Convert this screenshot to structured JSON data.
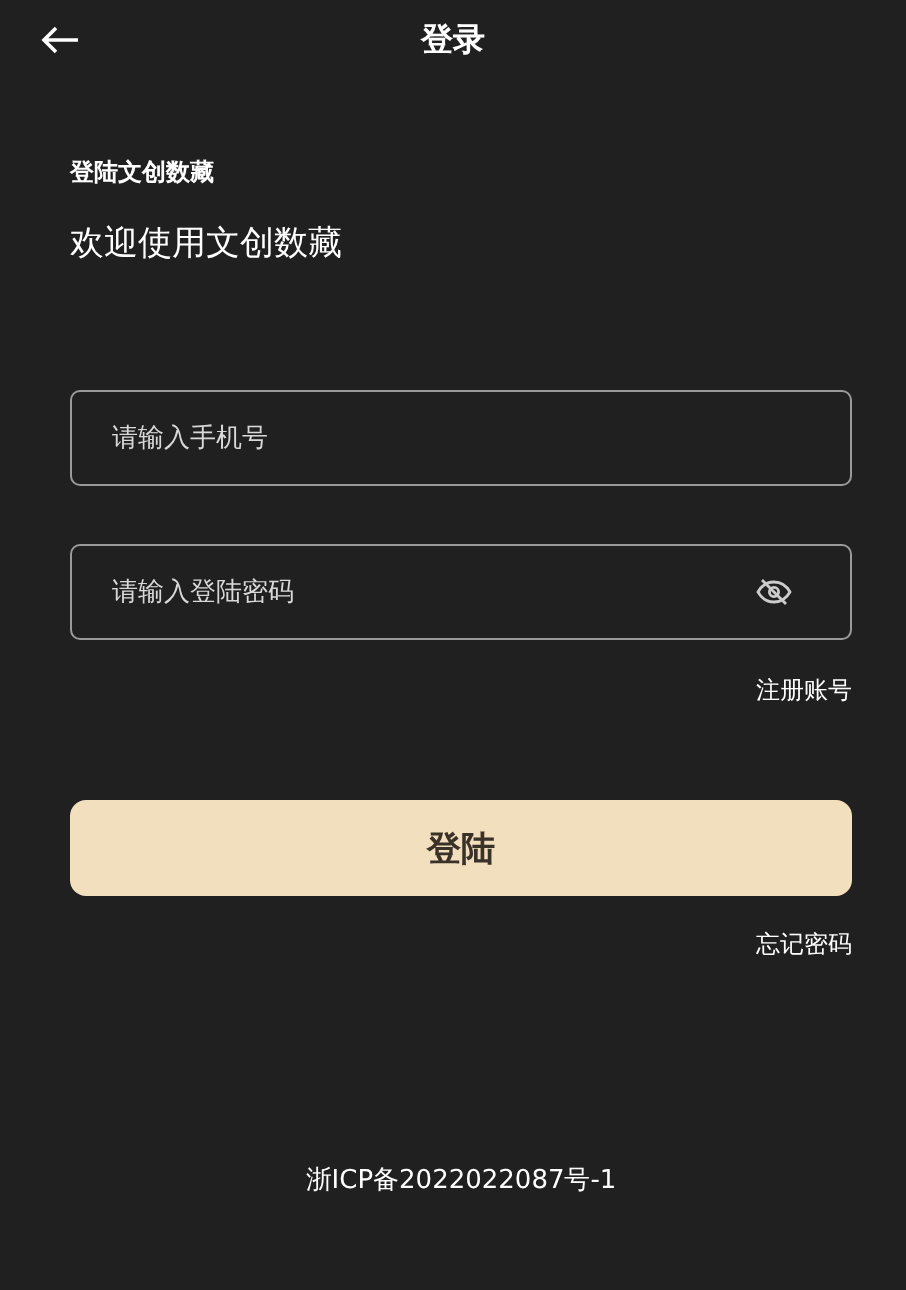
{
  "header": {
    "title": "登录"
  },
  "intro": {
    "subtitle": "登陆文创数藏",
    "heading": "欢迎使用文创数藏"
  },
  "fields": [
    {
      "placeholder": "请输入手机号",
      "kind": "phone"
    },
    {
      "placeholder": "请输入登陆密码",
      "kind": "password"
    }
  ],
  "register_link": "注册账号",
  "login_button": "登陆",
  "forgot_link": "忘记密码",
  "footer": "浙ICP备2022022087号-1"
}
